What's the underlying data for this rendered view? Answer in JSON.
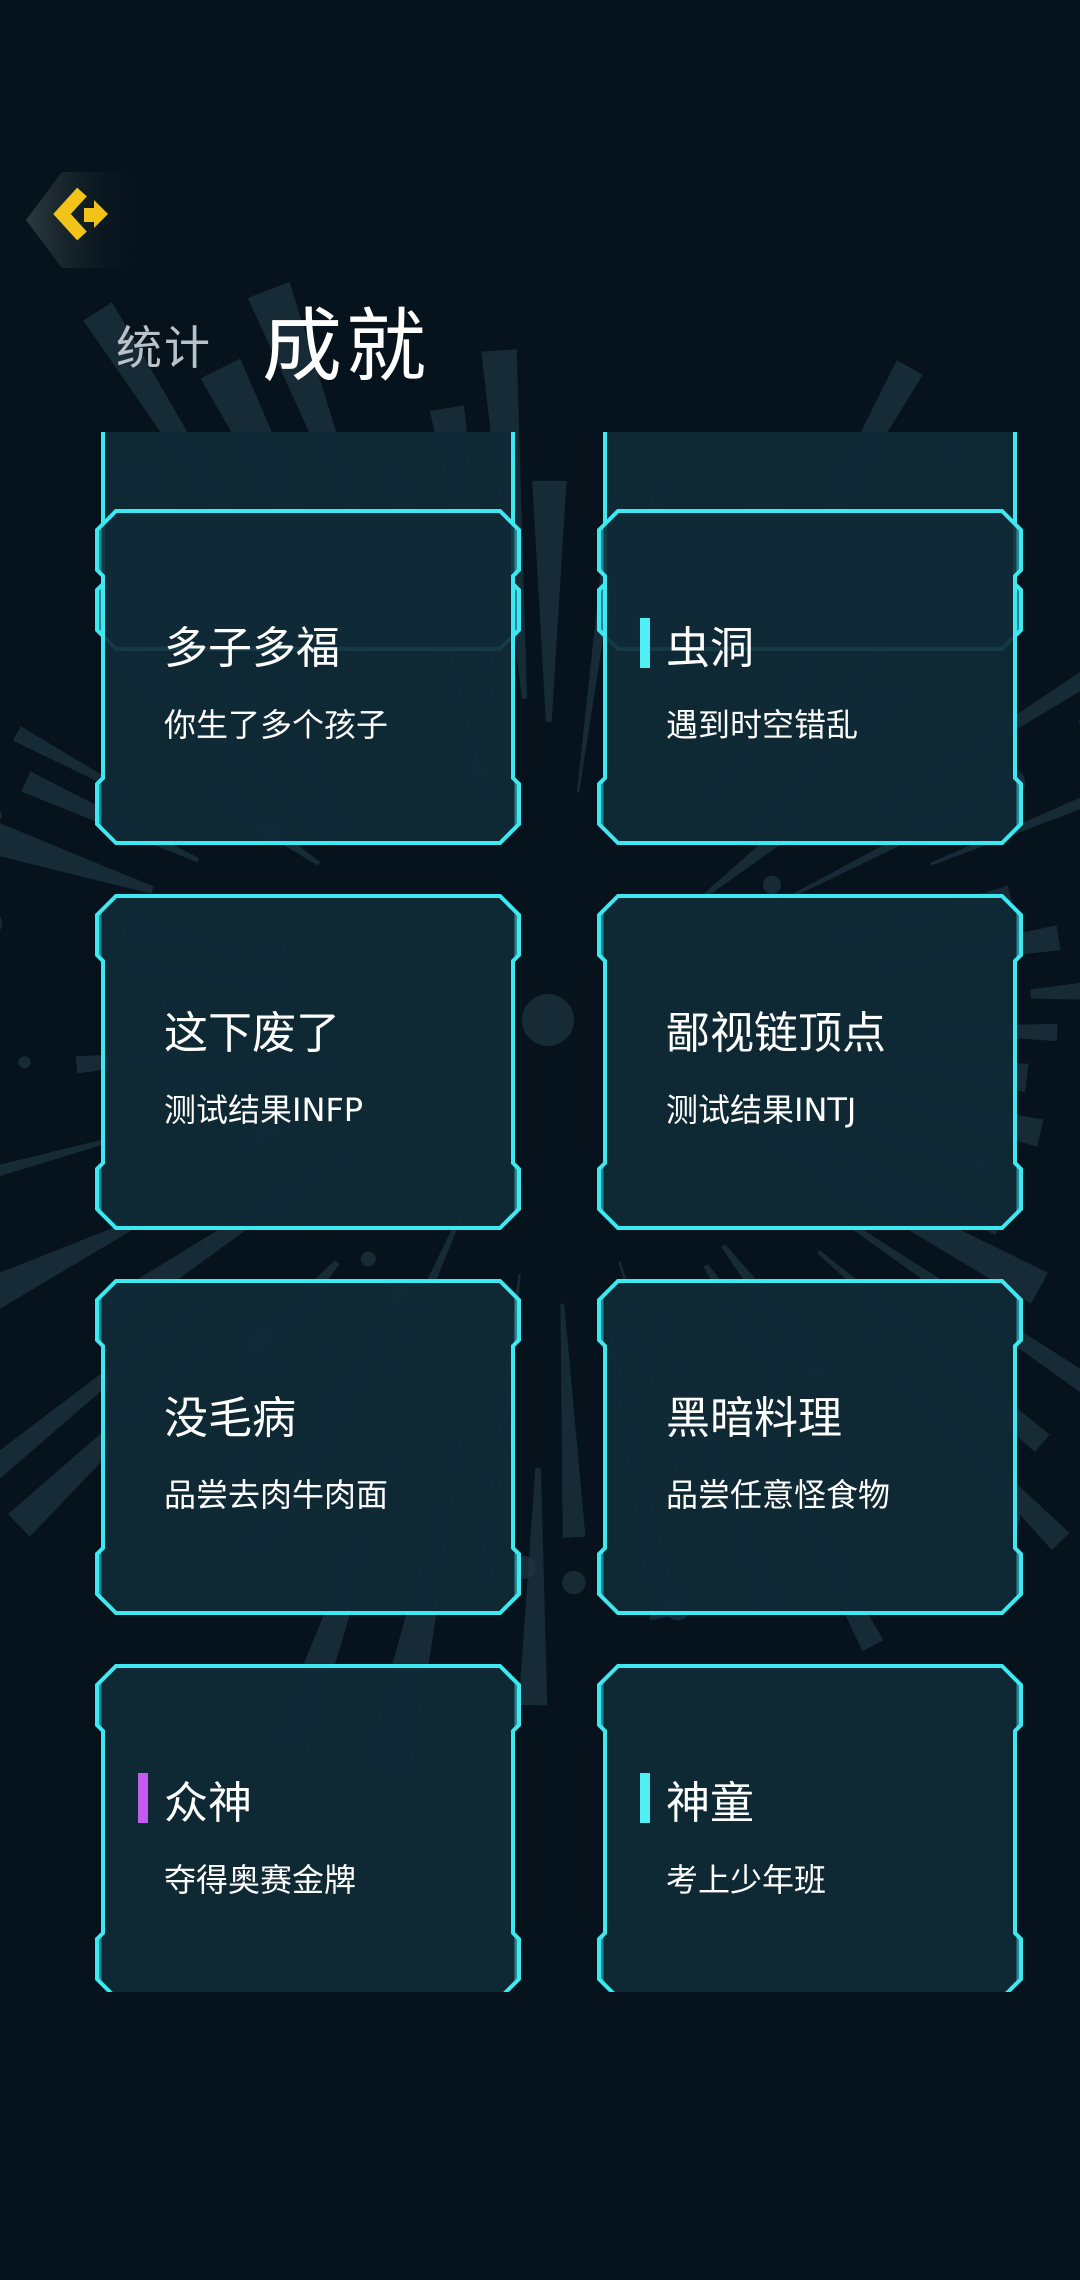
{
  "header": {
    "tab_stats": "统计",
    "tab_achievements": "成就",
    "back_icon": "chevron-left-icon"
  },
  "colors": {
    "background": "#06131d",
    "card_fill": "#0f2a36",
    "card_border": "#3ee8f0",
    "back_button": "#f2c318",
    "marker_cyan": "#4ff0f5",
    "marker_purple": "#c25cf0"
  },
  "achievements": [
    {
      "title": "多子多福",
      "desc": "你生了多个孩子",
      "marker": ""
    },
    {
      "title": "虫洞",
      "desc": "遇到时空错乱",
      "marker": "cyan"
    },
    {
      "title": "这下废了",
      "desc": "测试结果INFP",
      "marker": ""
    },
    {
      "title": "鄙视链顶点",
      "desc": "测试结果INTJ",
      "marker": ""
    },
    {
      "title": "没毛病",
      "desc": "品尝去肉牛肉面",
      "marker": ""
    },
    {
      "title": "黑暗料理",
      "desc": "品尝任意怪食物",
      "marker": ""
    },
    {
      "title": "众神",
      "desc": "夺得奥赛金牌",
      "marker": "purple"
    },
    {
      "title": "神童",
      "desc": "考上少年班",
      "marker": "cyan"
    }
  ]
}
